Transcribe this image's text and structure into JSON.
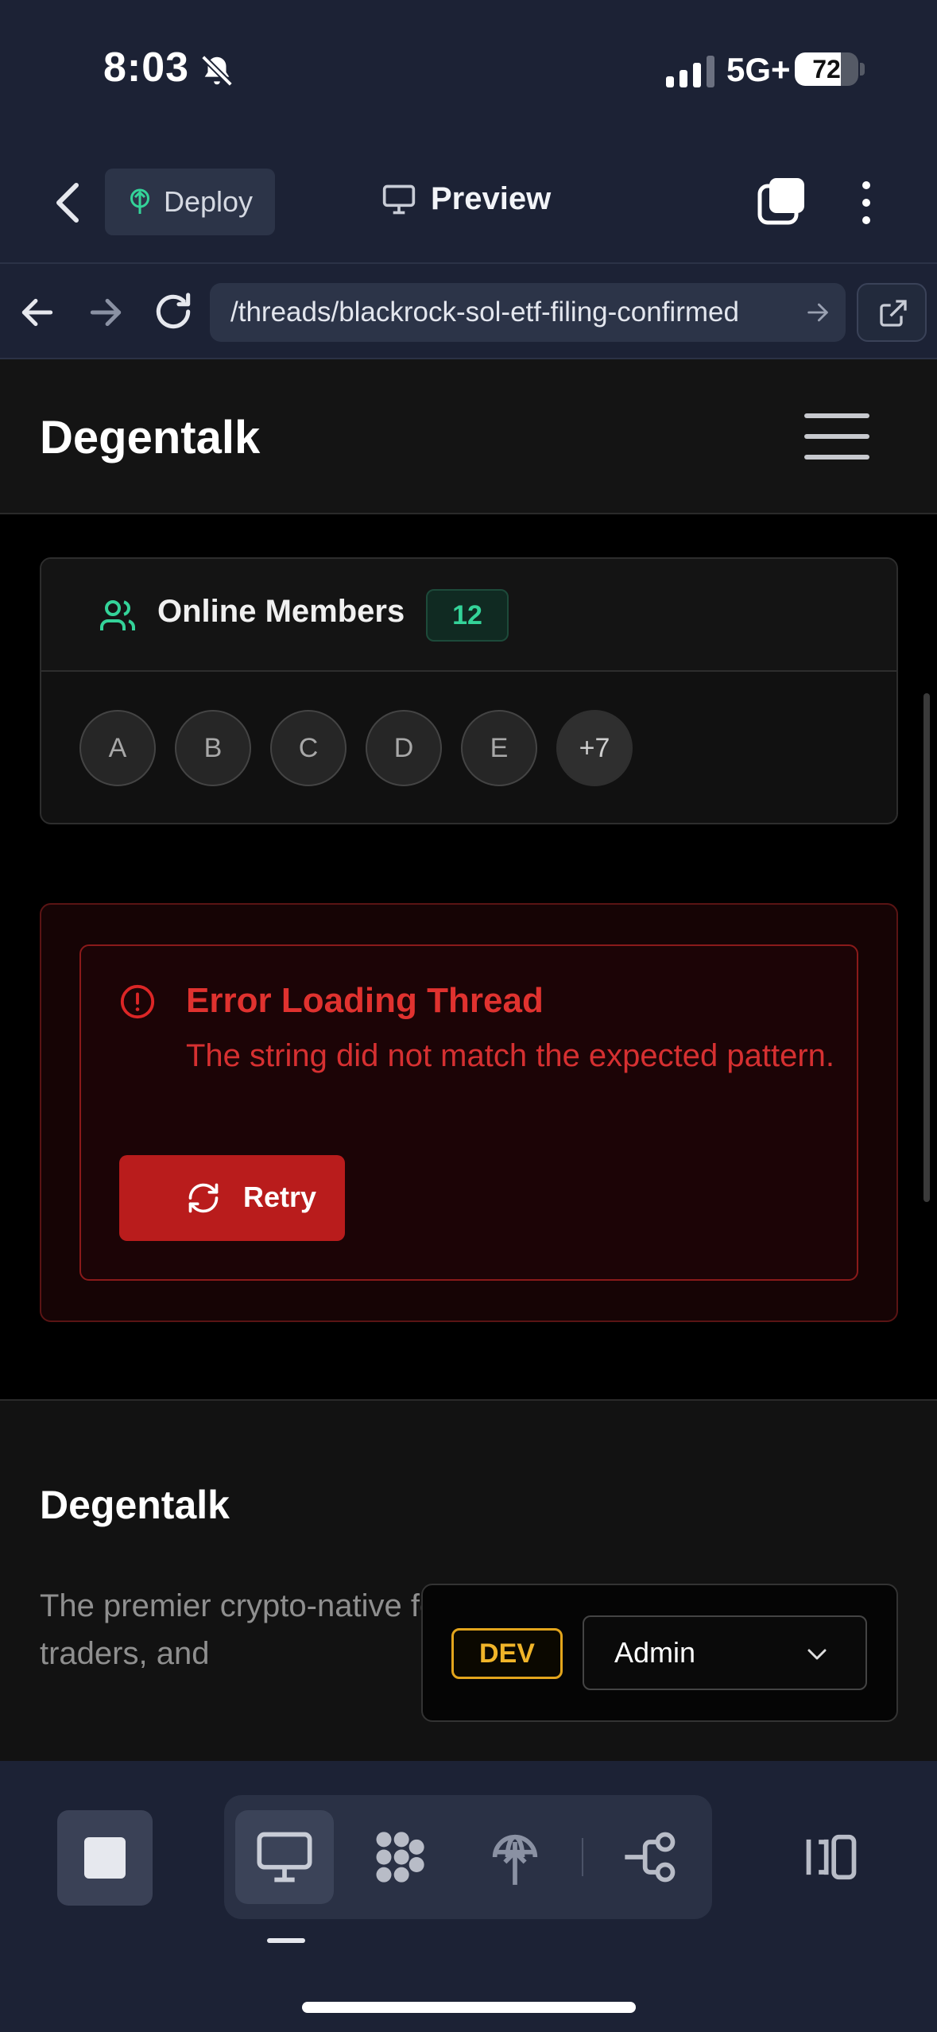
{
  "status_bar": {
    "time": "8:03",
    "network": "5G+",
    "battery": "72",
    "battery_level": 0.72
  },
  "app_bar": {
    "deploy_label": "Deploy",
    "preview_label": "Preview"
  },
  "browser": {
    "url": "/threads/blackrock-sol-etf-filing-confirmed"
  },
  "site": {
    "brand": "Degentalk"
  },
  "online_members": {
    "title": "Online Members",
    "count": "12",
    "avatars": [
      "A",
      "B",
      "C",
      "D",
      "E",
      "+7"
    ]
  },
  "error": {
    "title": "Error Loading Thread",
    "message": "The string did not match the expected pattern.",
    "retry_label": "Retry"
  },
  "footer": {
    "brand": "Degentalk",
    "description": "The premier crypto-native forum for crypto enthusiasts, traders, and"
  },
  "dev_panel": {
    "badge": "DEV",
    "role": "Admin"
  },
  "colors": {
    "chrome_bg": "#1c2235",
    "accent_green": "#34d399",
    "error_red": "#b91c1c",
    "dev_amber": "#f0b429"
  }
}
